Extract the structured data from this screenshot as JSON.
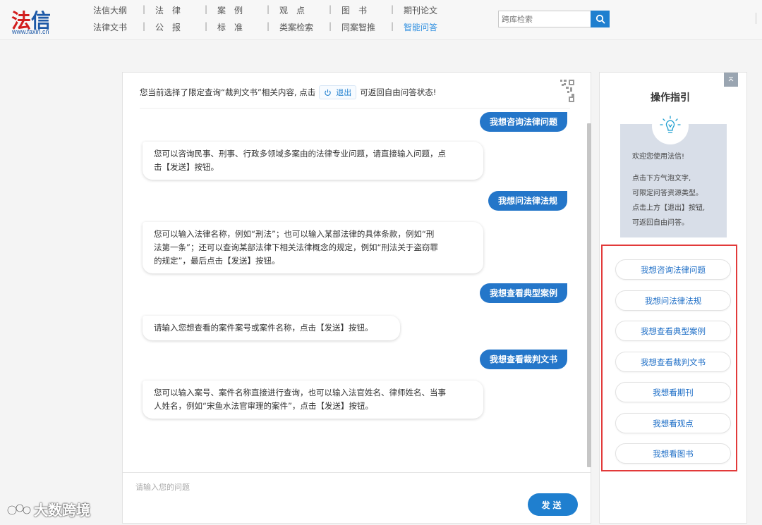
{
  "logo": {
    "main_red": "法",
    "main_blue": "信",
    "url": "www.faxin.cn"
  },
  "nav": {
    "row1": [
      "法信大纲",
      "法　律",
      "案　例",
      "观　点",
      "图　书",
      "期刊论文"
    ],
    "row2": [
      "法律文书",
      "公　报",
      "标　准",
      "类案检索",
      "同案智推",
      "智能问答"
    ],
    "separator": "|"
  },
  "search": {
    "placeholder": "跨库检索",
    "icon": "search-icon"
  },
  "chat": {
    "notice_pre": "您当前选择了限定查询“裁判文书”相关内容, 点击",
    "exit_label": "退出",
    "notice_post": "可返回自由问答状态!",
    "messages": [
      {
        "role": "user",
        "text": "我想咨询法律问题"
      },
      {
        "role": "bot",
        "line1": "您可以咨询民事、刑事、行政多领域多案由的法律专业问题，请直接输入问题，点",
        "line2": "击【发送】按钮。"
      },
      {
        "role": "user",
        "text": "我想问法律法规"
      },
      {
        "role": "bot",
        "line1": "您可以输入法律名称，例如“刑法”；也可以输入某部法律的具体条款，例如“刑",
        "line2": "法第一条”；还可以查询某部法律下相关法律概念的规定，例如“刑法关于盗窃罪",
        "line3": "的规定”，最后点击【发送】按钮。"
      },
      {
        "role": "user",
        "text": "我想查看典型案例"
      },
      {
        "role": "bot",
        "line1": "请输入您想查看的案件案号或案件名称，点击【发送】按钮。"
      },
      {
        "role": "user",
        "text": "我想查看裁判文书"
      },
      {
        "role": "bot",
        "line1": "您可以输入案号、案件名称直接进行查询，也可以输入法官姓名、律师姓名、当事",
        "line2": "人姓名，例如“宋鱼水法官审理的案件”，点击【发送】按钮。"
      }
    ],
    "input_placeholder": "请输入您的问题",
    "send_label": "发送"
  },
  "guide": {
    "title": "操作指引",
    "lines": [
      "欢迎您使用法信!",
      "点击下方气泡文字,",
      "可限定问答资源类型。",
      "点击上方【退出】按钮,",
      "可返回自由问答。"
    ],
    "buttons": [
      "我想咨询法律问题",
      "我想问法律法规",
      "我想查看典型案例",
      "我想查看裁判文书",
      "我想看期刊",
      "我想看观点",
      "我想看图书"
    ]
  },
  "watermark": "大数跨境",
  "colors": {
    "accent": "#1f7fcf",
    "highlight": "#e23a3a",
    "logo_red": "#d21e1e",
    "logo_blue": "#1d59a7"
  }
}
